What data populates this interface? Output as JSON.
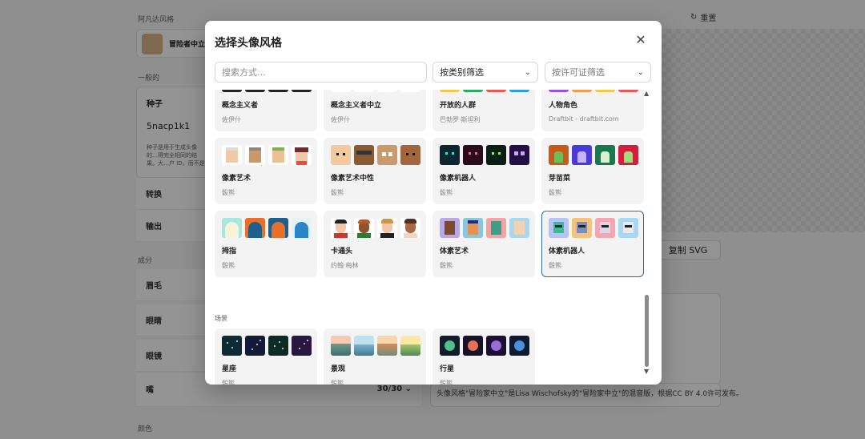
{
  "background": {
    "style_label": "阿凡达风格",
    "current_style": "冒险者中立",
    "general_label": "一般的",
    "seed_label": "种子",
    "seed_value": "5nacp1k1",
    "seed_help": "种子是用于生成头像的…得完全相同的结果。大…户 ID，而不是姓名或…",
    "transform_label": "转换",
    "output_label": "输出",
    "components_label": "成分",
    "eyebrows_label": "眉毛",
    "eyes_label": "眼睛",
    "glasses_label": "眼镜",
    "mouth_label": "嘴",
    "mouth_count": "30/30",
    "color_label": "颜色",
    "reset_label": "重置",
    "copy_svg_label": "复制 SVG",
    "license_text": "头像风格\"冒险家中立\"是Lisa Wischofsky的\"冒险家中立\"的混音版，根据CC BY 4.0许可发布。"
  },
  "modal": {
    "title": "选择头像风格",
    "search_placeholder": "搜索方式...",
    "category_filter": "按类别筛选",
    "license_filter": "按许可证筛选",
    "scenes_section": "场景",
    "styles": [
      {
        "name": "概念主义者",
        "author": "佐伊什"
      },
      {
        "name": "概念主义者中立",
        "author": "佐伊什"
      },
      {
        "name": "开放的人群",
        "author": "巴勃罗·斯坦利"
      },
      {
        "name": "人物角色",
        "author": "Draftbit - draftbit.com"
      },
      {
        "name": "像素艺术",
        "author": "骰熊"
      },
      {
        "name": "像素艺术中性",
        "author": "骰熊"
      },
      {
        "name": "像素机器人",
        "author": "骰熊"
      },
      {
        "name": "芽苗菜",
        "author": "骰熊"
      },
      {
        "name": "拇指",
        "author": "骰熊"
      },
      {
        "name": "卡通头",
        "author": "约翰·梅林"
      },
      {
        "name": "体素艺术",
        "author": "骰熊"
      },
      {
        "name": "体素机器人",
        "author": "骰熊"
      }
    ],
    "scenes": [
      {
        "name": "星座",
        "author": "骰熊"
      },
      {
        "name": "景观",
        "author": "骰熊"
      },
      {
        "name": "行星",
        "author": "骰熊"
      }
    ]
  }
}
